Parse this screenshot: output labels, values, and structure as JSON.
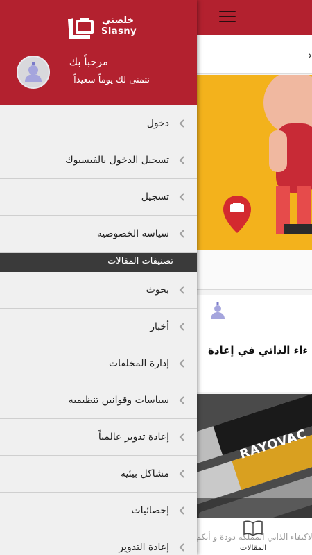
{
  "drawer": {
    "logo": {
      "text_ar": "خلصني",
      "text_en": "Slasny"
    },
    "welcome": "مرحباً بك",
    "wish": "نتمنى لك يوماً سعيداً",
    "account_items": [
      {
        "label": "دخول"
      },
      {
        "label": "تسجيل الدخول بالفيسبوك"
      },
      {
        "label": "تسجيل"
      },
      {
        "label": "سياسة الخصوصية"
      }
    ],
    "categories_header": "تصنيفات المقالات",
    "category_items": [
      {
        "label": "بحوث"
      },
      {
        "label": "أخبار"
      },
      {
        "label": "إدارة المخلفات"
      },
      {
        "label": "سياسات وقوانين تنظيميه"
      },
      {
        "label": "إعادة تدوير عالمياً"
      },
      {
        "label": "مشاكل بيئية"
      },
      {
        "label": "إحصائيات"
      },
      {
        "label": "إعادة التدوير"
      }
    ]
  },
  "background": {
    "card_title": "ءاء الذاتي في إعادة",
    "excerpt": "الاكتفاء الذاتي المملكة دودة و أنكم",
    "photo_brand": "RAYOVAC",
    "bottom_tab_label": "المقالات"
  },
  "colors": {
    "brand_red": "#b3212f",
    "banner_yellow": "#f3b21c",
    "section_dark": "#3a3a3a"
  }
}
